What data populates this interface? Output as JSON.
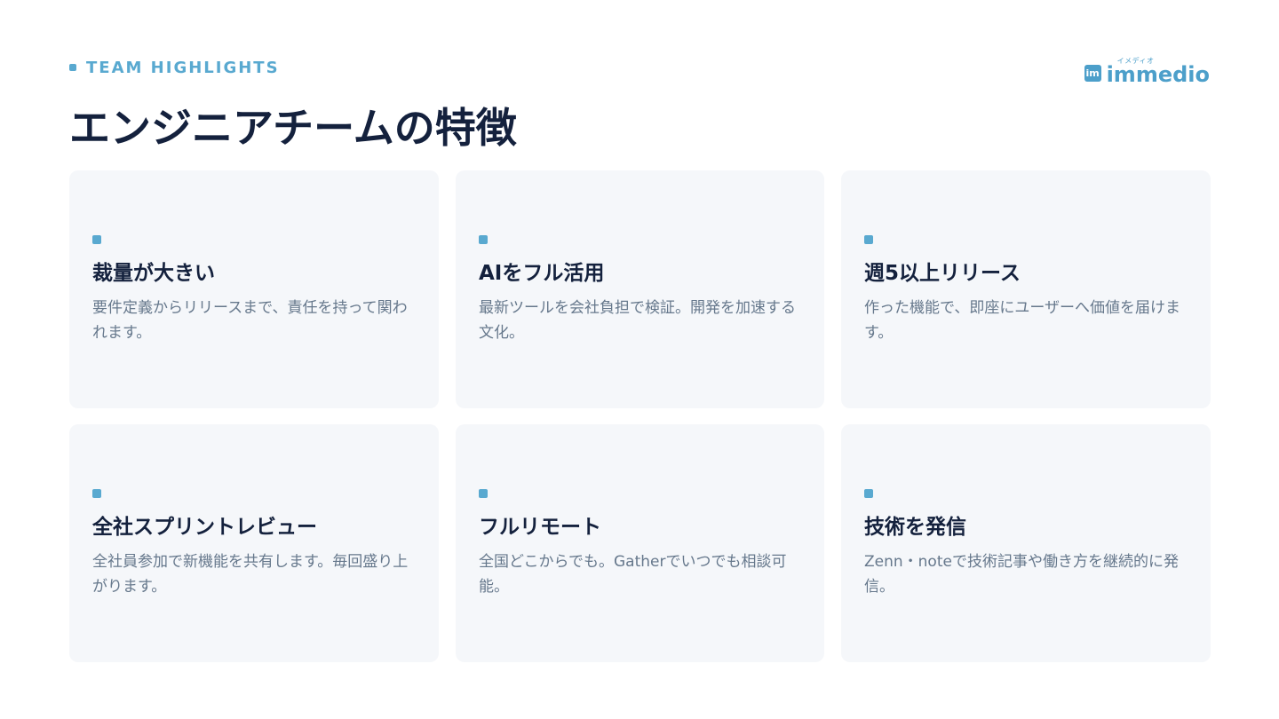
{
  "header": {
    "eyebrow": "TEAM HIGHLIGHTS",
    "title": "エンジニアチームの特徴"
  },
  "brand": {
    "icon_label": "im",
    "kana": "イメディオ",
    "name": "immedio"
  },
  "cards": [
    {
      "title": "裁量が大きい",
      "description": "要件定義からリリースまで、責任を持って関われます。"
    },
    {
      "title": "AIをフル活用",
      "description": "最新ツールを会社負担で検証。開発を加速する文化。"
    },
    {
      "title": "週5以上リリース",
      "description": "作った機能で、即座にユーザーへ価値を届けます。"
    },
    {
      "title": "全社スプリントレビュー",
      "description": "全社員参加で新機能を共有します。毎回盛り上がります。"
    },
    {
      "title": "フルリモート",
      "description": "全国どこからでも。Gatherでいつでも相談可能。"
    },
    {
      "title": "技術を発信",
      "description": "Zenn・noteで技術記事や働き方を継続的に発信。"
    }
  ],
  "colors": {
    "accent": "#59a9d0",
    "brand": "#4c9fca",
    "heading": "#14213d",
    "body_text": "#66788c",
    "card_background": "#f5f7fa"
  }
}
